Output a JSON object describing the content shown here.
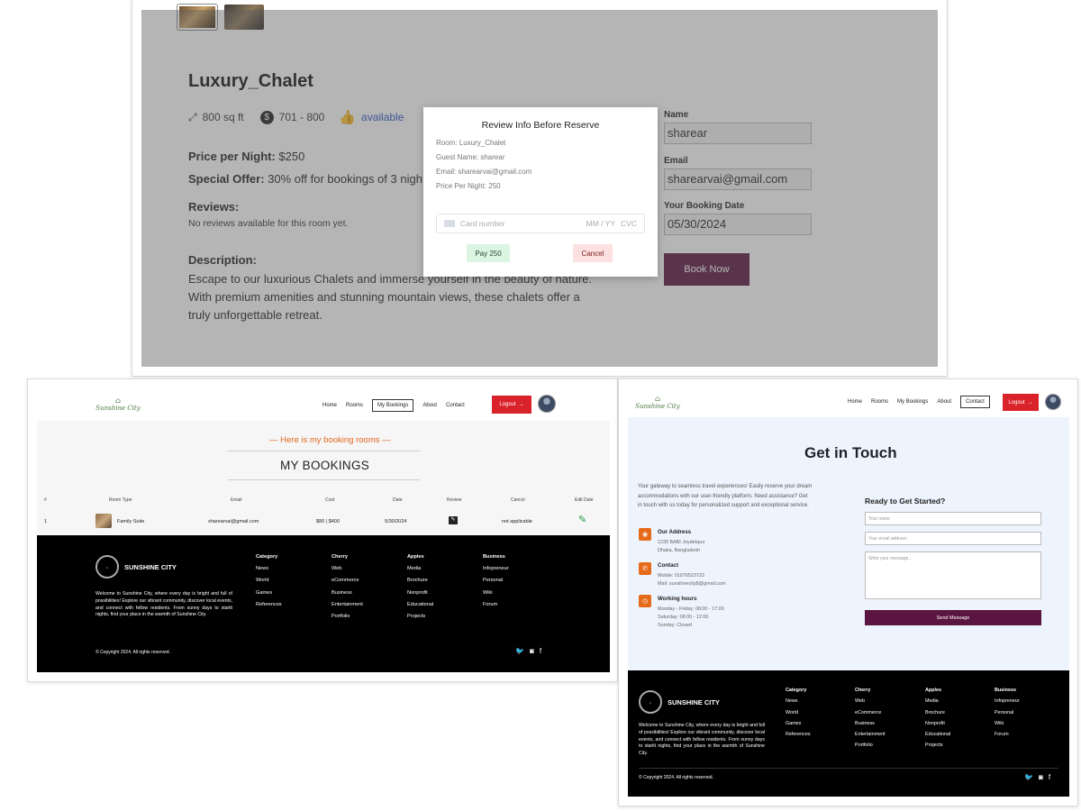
{
  "room_details": {
    "title": "Luxury_Chalet",
    "size": "800 sq ft",
    "price_range": "701 - 800",
    "availability": "available",
    "price_label": "Price per Night:",
    "price_value": "$250",
    "offer_label": "Special Offer:",
    "offer_value": "30% off for bookings of 3 nigh",
    "reviews_label": "Reviews:",
    "reviews_value": "No reviews available for this room yet.",
    "description_label": "Description:",
    "description_lines": [
      "Escape to our luxurious Chalets and immerse yourself in the beauty of nature.",
      "With premium amenities and stunning mountain views, these chalets offer a",
      "truly unforgettable retreat."
    ],
    "form": {
      "name_label": "Name",
      "name_value": "sharear",
      "email_label": "Email",
      "email_value": "sharearvai@gmail.com",
      "date_label": "Your Booking Date",
      "date_value": "05/30/2024",
      "book_button": "Book Now"
    },
    "modal": {
      "title": "Review Info Before Reserve",
      "room": "Room: Luxury_Chalet",
      "guest": "Guest Name: sharear",
      "email": "Email: sharearvai@gmail.com",
      "price": "Price Per Night: 250",
      "card_placeholder": "Card number",
      "card_expiry_placeholder": "MM / YY",
      "card_cvc_placeholder": "CVC",
      "pay_button": "Pay 250",
      "cancel_button": "Cancel"
    }
  },
  "bookings_page": {
    "logo_text": "Sunshine City",
    "nav": [
      "Home",
      "Rooms",
      "My Bookings",
      "About",
      "Contact"
    ],
    "logout": "Logout",
    "subtitle": "Here is my booking rooms",
    "title": "MY BOOKINGS",
    "columns": [
      "#",
      "Room Type",
      "Email",
      "Cost",
      "Date",
      "Review",
      "Cancel",
      "Edit Date"
    ],
    "row": {
      "index": "1",
      "room_type": "Family Suite",
      "email": "sharearvai@gmail.com",
      "cost_a": "$80 |",
      "cost_b": "$400",
      "date": "5/30/2024",
      "cancel": "not applicable"
    }
  },
  "contact_page": {
    "logo_text": "Sunshine City",
    "nav": [
      "Home",
      "Rooms",
      "My Bookings",
      "About",
      "Contact"
    ],
    "logout": "Logout",
    "title": "Get in Touch",
    "intro": [
      "Your gateway to seamless travel experiences! Easily reserve your dream",
      "accommodations with our user-friendly platform. Need assistance? Get",
      "in touch with us today for personalized support and exceptional service."
    ],
    "address_heading": "Our Address",
    "address_lines": [
      "1230 BABI Joydebpur",
      "Dhaka, Bangladesh"
    ],
    "contact_heading": "Contact",
    "contact_lines": [
      "Mobile: 01876523723",
      "Mail: sunshinecity$@gmail.com"
    ],
    "hours_heading": "Working hours",
    "hours_lines": [
      "Monday - Friday: 08:00 - 17:00",
      "Saturday: 08:00 - 12:00",
      "Sunday: Closed"
    ],
    "form_heading": "Ready to Get Started?",
    "name_placeholder": "Your name",
    "email_placeholder": "Your email address",
    "message_placeholder": "Write your message...",
    "send_button": "Send Message"
  },
  "footer": {
    "brand": "SUNSHINE CITY",
    "about": "Welcome to Sunshine City, where every day is bright and full of possibilities! Explore our vibrant community, discover local events, and connect with fellow residents. From sunny days to starlit nights, find your place in the warmth of Sunshine City.",
    "columns": [
      {
        "heading": "Category",
        "items": [
          "News",
          "World",
          "Games",
          "References"
        ]
      },
      {
        "heading": "Cherry",
        "items": [
          "Web",
          "eCommerce",
          "Business",
          "Entertainment",
          "Portfolio"
        ]
      },
      {
        "heading": "Apples",
        "items": [
          "Media",
          "Brochure",
          "Nonprofit",
          "Educational",
          "Projects"
        ]
      },
      {
        "heading": "Business",
        "items": [
          "Infopreneur",
          "Personal",
          "Wiki",
          "Forum"
        ]
      }
    ],
    "copyright": "© Copyright 2024. All rights reserved."
  },
  "colors": {
    "accent_maroon": "#5a1540",
    "logout_red": "#d9222a",
    "orange": "#e56a1a",
    "link_blue": "#2554c7"
  }
}
